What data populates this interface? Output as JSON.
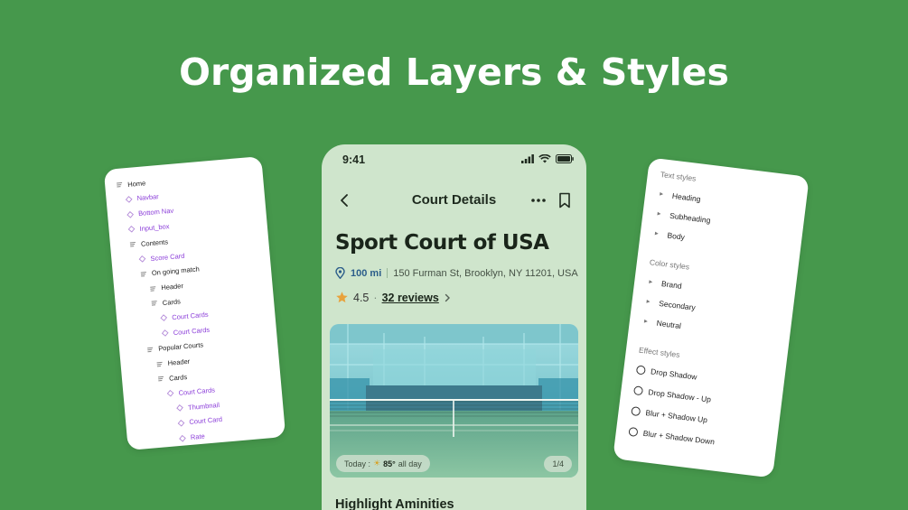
{
  "headline": "Organized Layers & Styles",
  "layers": [
    {
      "label": "Home",
      "type": "frame",
      "depth": 0
    },
    {
      "label": "Navbar",
      "type": "comp",
      "depth": 1
    },
    {
      "label": "Bottom Nav",
      "type": "comp",
      "depth": 1
    },
    {
      "label": "Input_box",
      "type": "comp",
      "depth": 1
    },
    {
      "label": "Contents",
      "type": "frame",
      "depth": 1
    },
    {
      "label": "Score Card",
      "type": "comp",
      "depth": 2
    },
    {
      "label": "On going match",
      "type": "frame",
      "depth": 2
    },
    {
      "label": "Header",
      "type": "frame",
      "depth": 3
    },
    {
      "label": "Cards",
      "type": "frame",
      "depth": 3
    },
    {
      "label": "Court Cards",
      "type": "comp",
      "depth": 4
    },
    {
      "label": "Court Cards",
      "type": "comp",
      "depth": 4
    },
    {
      "label": "Popular Courts",
      "type": "frame",
      "depth": 2
    },
    {
      "label": "Header",
      "type": "frame",
      "depth": 3
    },
    {
      "label": "Cards",
      "type": "frame",
      "depth": 3
    },
    {
      "label": "Court Cards",
      "type": "comp",
      "depth": 4
    },
    {
      "label": "Thumbnail",
      "type": "comp",
      "depth": 5
    },
    {
      "label": "Court Card",
      "type": "comp",
      "depth": 5
    },
    {
      "label": "Rate",
      "type": "comp",
      "depth": 5
    }
  ],
  "phone": {
    "time": "9:41",
    "nav_title": "Court Details",
    "title": "Sport Court of USA",
    "distance": "100 mi",
    "address": "150 Furman St, Brooklyn, NY 11201, USA",
    "rating": "4.5",
    "rating_sep": "·",
    "reviews": "32 reviews",
    "weather_prefix": "Today :",
    "weather_temp": "85°",
    "weather_suffix": "all day",
    "photo_counter": "1/4",
    "section_title": "Highlight Aminities"
  },
  "styles": {
    "text_heading": "Text styles",
    "text_items": [
      "Heading",
      "Subheading",
      "Body"
    ],
    "color_heading": "Color styles",
    "color_items": [
      "Brand",
      "Secondary",
      "Neutral"
    ],
    "effect_heading": "Effect styles",
    "effect_items": [
      "Drop Shadow",
      "Drop Shadow - Up",
      "Blur + Shadow Up",
      "Blur + Shadow Down"
    ]
  },
  "colors": {
    "background": "#46984c",
    "phone_bg": "#cfe5cc",
    "component_purple": "#8b3dd9",
    "distance_blue": "#2b5d8a",
    "star": "#e8a23c"
  }
}
